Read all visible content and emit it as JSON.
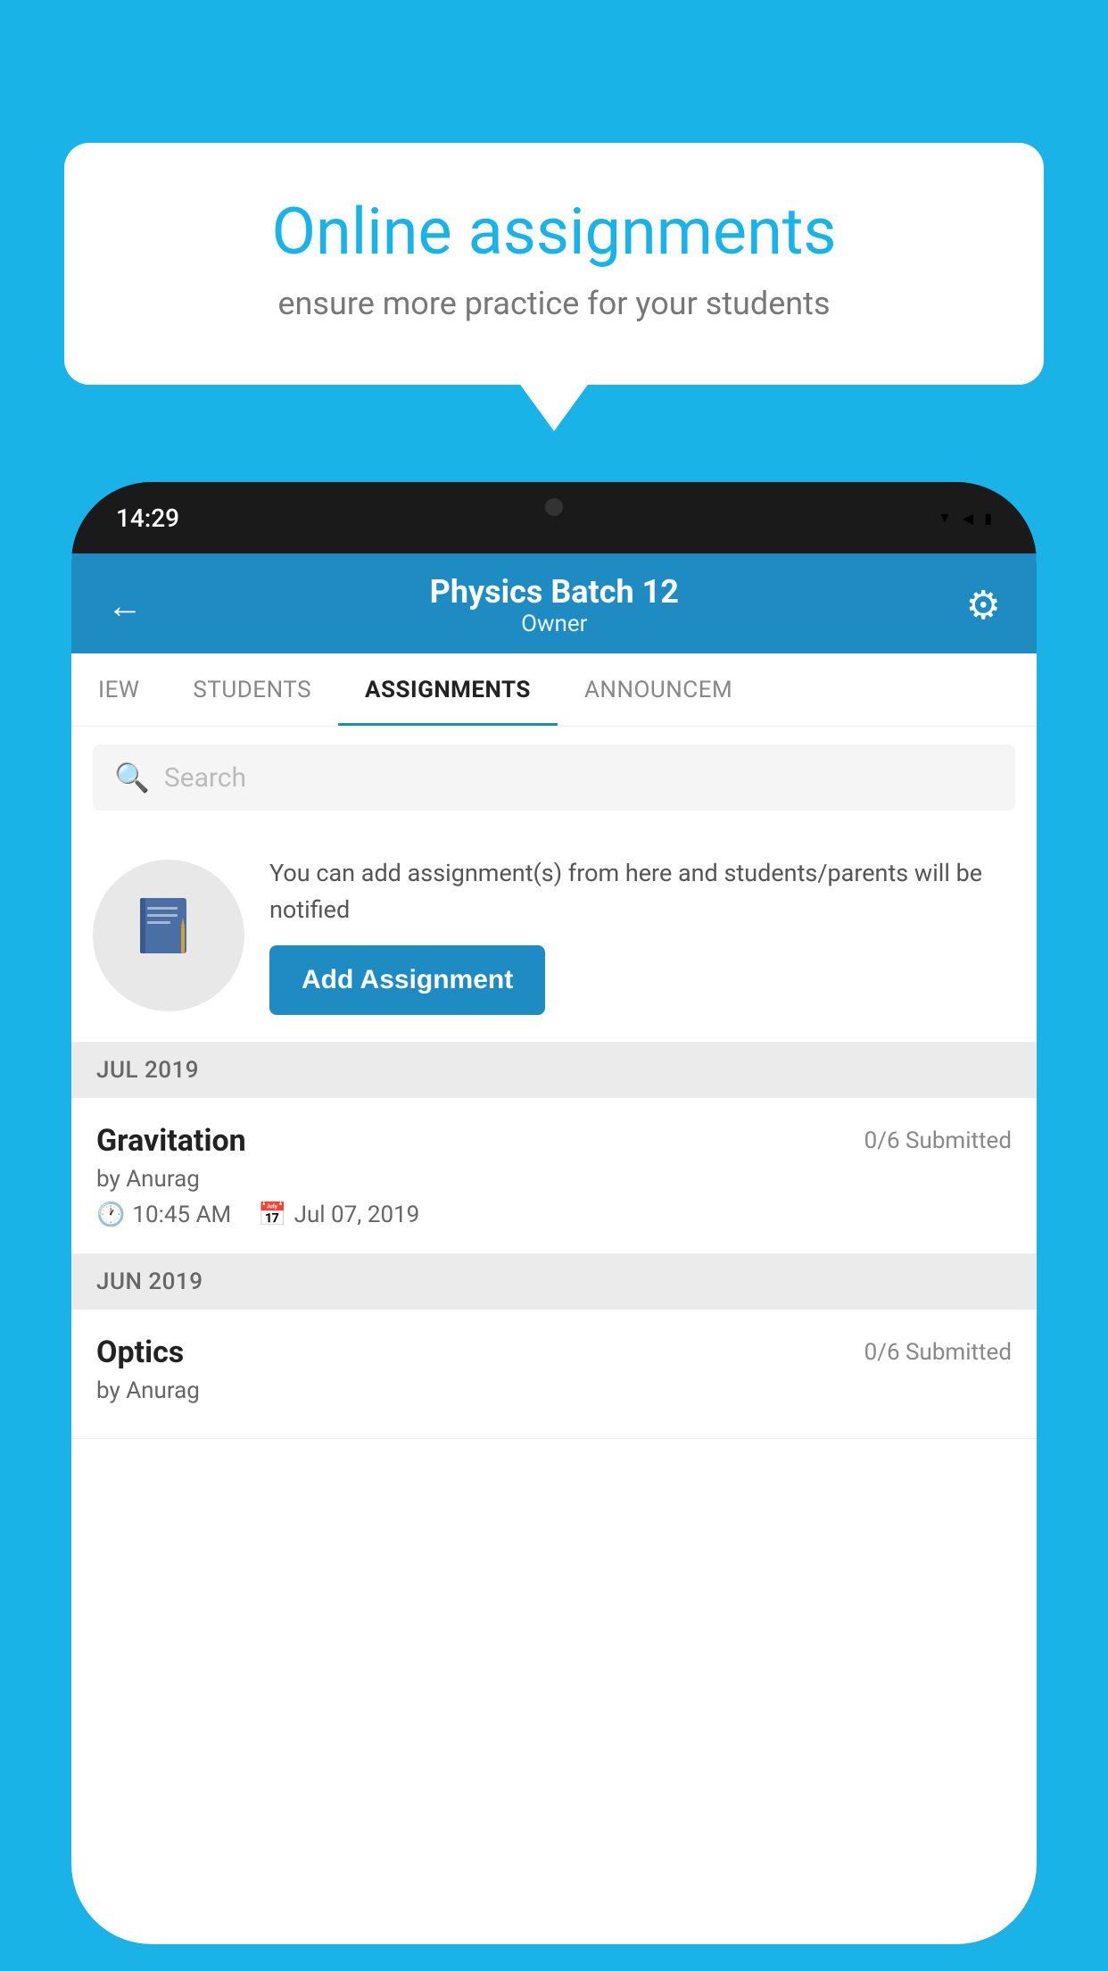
{
  "background": {
    "color": "#1ab3e8"
  },
  "speech_bubble": {
    "title": "Online assignments",
    "subtitle": "ensure more practice for your students"
  },
  "phone": {
    "time": "14:29",
    "status_icons": [
      "wifi",
      "signal",
      "battery"
    ]
  },
  "app": {
    "header": {
      "title": "Physics Batch 12",
      "subtitle": "Owner",
      "back_label": "←",
      "gear_label": "⚙"
    },
    "tabs": [
      {
        "label": "IEW",
        "active": false
      },
      {
        "label": "STUDENTS",
        "active": false
      },
      {
        "label": "ASSIGNMENTS",
        "active": true
      },
      {
        "label": "ANNOUNCEM",
        "active": false
      }
    ],
    "search": {
      "placeholder": "Search"
    },
    "promo": {
      "icon": "📓",
      "text": "You can add assignment(s) from here and students/parents will be notified",
      "button_label": "Add Assignment"
    },
    "sections": [
      {
        "month": "JUL 2019",
        "assignments": [
          {
            "name": "Gravitation",
            "submitted": "0/6 Submitted",
            "by": "by Anurag",
            "time": "10:45 AM",
            "date": "Jul 07, 2019"
          }
        ]
      },
      {
        "month": "JUN 2019",
        "assignments": [
          {
            "name": "Optics",
            "submitted": "0/6 Submitted",
            "by": "by Anurag",
            "time": "",
            "date": ""
          }
        ]
      }
    ]
  }
}
